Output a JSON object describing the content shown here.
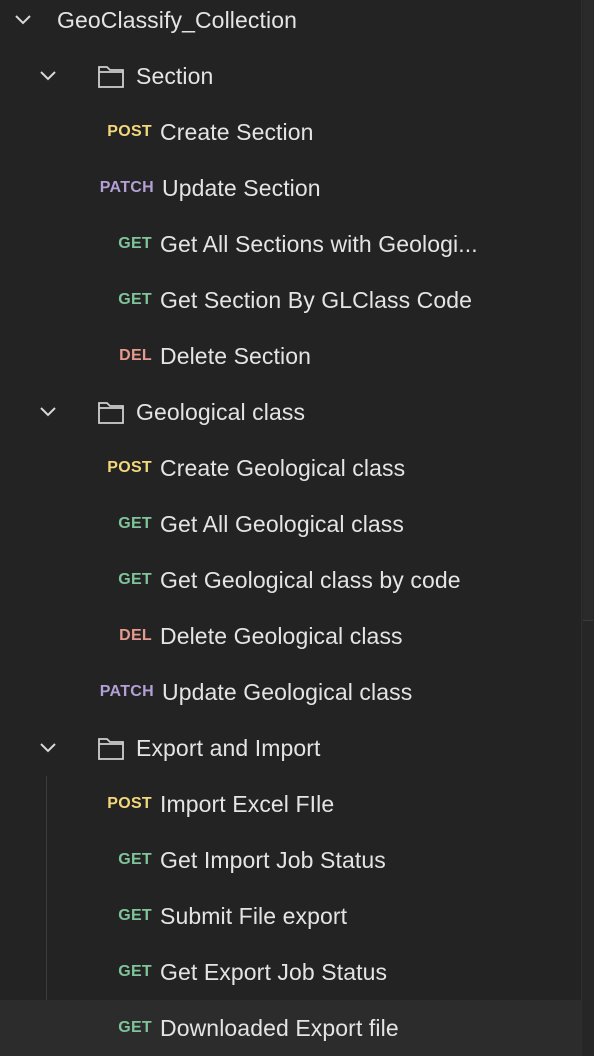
{
  "collection": {
    "name": "GeoClassify_Collection"
  },
  "folders": [
    {
      "name": "Section",
      "requests": [
        {
          "method": "POST",
          "name": "Create Section"
        },
        {
          "method": "PATCH",
          "name": "Update Section"
        },
        {
          "method": "GET",
          "name": "Get All Sections with Geologi..."
        },
        {
          "method": "GET",
          "name": "Get Section By GLClass Code"
        },
        {
          "method": "DEL",
          "name": "Delete Section"
        }
      ]
    },
    {
      "name": "Geological class",
      "requests": [
        {
          "method": "POST",
          "name": "Create Geological class"
        },
        {
          "method": "GET",
          "name": "Get All Geological class"
        },
        {
          "method": "GET",
          "name": "Get Geological class by code"
        },
        {
          "method": "DEL",
          "name": "Delete Geological class"
        },
        {
          "method": "PATCH",
          "name": "Update Geological class"
        }
      ]
    },
    {
      "name": "Export and Import",
      "requests": [
        {
          "method": "POST",
          "name": "Import Excel FIle"
        },
        {
          "method": "GET",
          "name": "Get Import Job Status"
        },
        {
          "method": "GET",
          "name": "Submit File export"
        },
        {
          "method": "GET",
          "name": "Get Export Job Status"
        },
        {
          "method": "GET",
          "name": "Downloaded Export file"
        }
      ]
    }
  ],
  "method_colors": {
    "POST": "#f3d77b",
    "GET": "#7fc49a",
    "PATCH": "#b49fd6",
    "DEL": "#e59a8e"
  },
  "icons": {
    "expand": "chevron-down-icon",
    "folder": "folder-icon"
  }
}
